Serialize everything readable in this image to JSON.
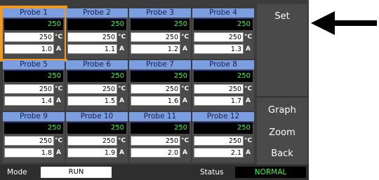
{
  "probes": [
    {
      "name": "Probe 1",
      "reading": "250",
      "setpoint": "250",
      "temp_unit": "°C",
      "current": "1.0",
      "current_unit": "A"
    },
    {
      "name": "Probe 2",
      "reading": "250",
      "setpoint": "250",
      "temp_unit": "°C",
      "current": "1.1",
      "current_unit": "A"
    },
    {
      "name": "Probe 3",
      "reading": "250",
      "setpoint": "250",
      "temp_unit": "°C",
      "current": "1.2",
      "current_unit": "A"
    },
    {
      "name": "Probe 4",
      "reading": "250",
      "setpoint": "250",
      "temp_unit": "°C",
      "current": "1.3",
      "current_unit": "A"
    },
    {
      "name": "Probe 5",
      "reading": "250",
      "setpoint": "250",
      "temp_unit": "°C",
      "current": "1.4",
      "current_unit": "A"
    },
    {
      "name": "Probe 6",
      "reading": "250",
      "setpoint": "250",
      "temp_unit": "°C",
      "current": "1.5",
      "current_unit": "A"
    },
    {
      "name": "Probe 7",
      "reading": "250",
      "setpoint": "250",
      "temp_unit": "°C",
      "current": "1.6",
      "current_unit": "A"
    },
    {
      "name": "Probe 8",
      "reading": "250",
      "setpoint": "250",
      "temp_unit": "°C",
      "current": "1.7",
      "current_unit": "A"
    },
    {
      "name": "Probe 9",
      "reading": "250",
      "setpoint": "250",
      "temp_unit": "°C",
      "current": "1.8",
      "current_unit": "A"
    },
    {
      "name": "Probe 10",
      "reading": "250",
      "setpoint": "250",
      "temp_unit": "°C",
      "current": "1.9",
      "current_unit": "A"
    },
    {
      "name": "Probe 11",
      "reading": "250",
      "setpoint": "250",
      "temp_unit": "°C",
      "current": "2.0",
      "current_unit": "A"
    },
    {
      "name": "Probe 12",
      "reading": "250",
      "setpoint": "250",
      "temp_unit": "°C",
      "current": "2.1",
      "current_unit": "A"
    }
  ],
  "selected_probe": "Probe 1",
  "side_buttons": {
    "set": "Set",
    "blank1": "",
    "blank2": "",
    "blank3": "",
    "graph": "Graph",
    "zoom": "Zoom",
    "back": "Back"
  },
  "status_bar": {
    "mode_label": "Mode",
    "mode_value": "RUN",
    "status_label": "Status",
    "status_value": "NORMAL"
  },
  "icons": {
    "pointer": "arrow-left-icon"
  },
  "colors": {
    "panel": "#3c3c3c",
    "probe_header": "#7b9ee0",
    "reading_text": "#33ff33",
    "selection": "#f39a1e",
    "status_ok": "#33ff33"
  }
}
